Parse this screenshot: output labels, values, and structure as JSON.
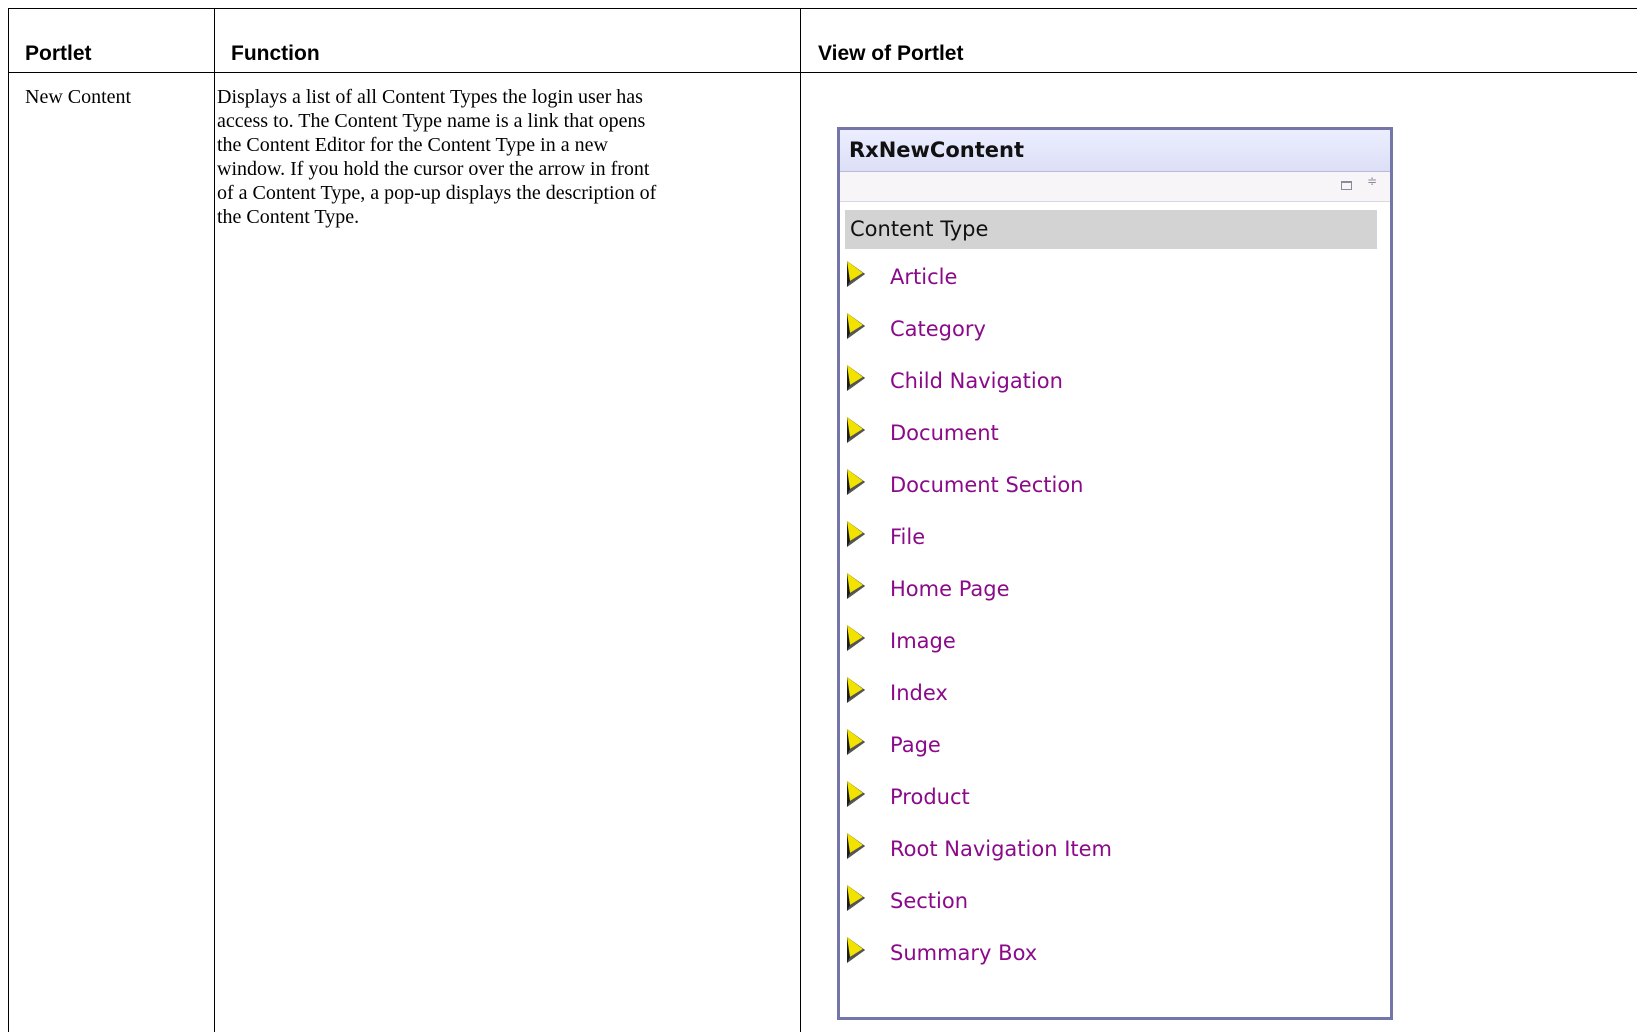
{
  "table": {
    "headers": {
      "portlet": "Portlet",
      "function": "Function",
      "view": "View of Portlet"
    },
    "row": {
      "portlet_name": "New Content",
      "function_lines": [
        "Displays a list of all Content Types the login user has",
        "access to. The Content Type name is a link that opens",
        "the Content Editor for the Content Type in a new",
        "window. If you hold the cursor over the arrow in front",
        "of a Content Type, a pop-up displays the description of",
        "the Content Type."
      ]
    }
  },
  "portlet": {
    "title": "RxNewContent",
    "controls": {
      "maximize_icon": "maximize-icon",
      "minimize_icon": "up-down-icon",
      "updown_glyph": "≑"
    },
    "column_header": "Content Type",
    "items": [
      "Article",
      "Category",
      "Child Navigation",
      "Document",
      "Document Section",
      "File",
      "Home Page",
      "Image",
      "Index",
      "Page",
      "Product",
      "Root Navigation Item",
      "Section",
      "Summary Box"
    ],
    "colors": {
      "border": "#7475a9",
      "link": "#8a0a8a",
      "header_bg": "#d3d3d3"
    }
  }
}
